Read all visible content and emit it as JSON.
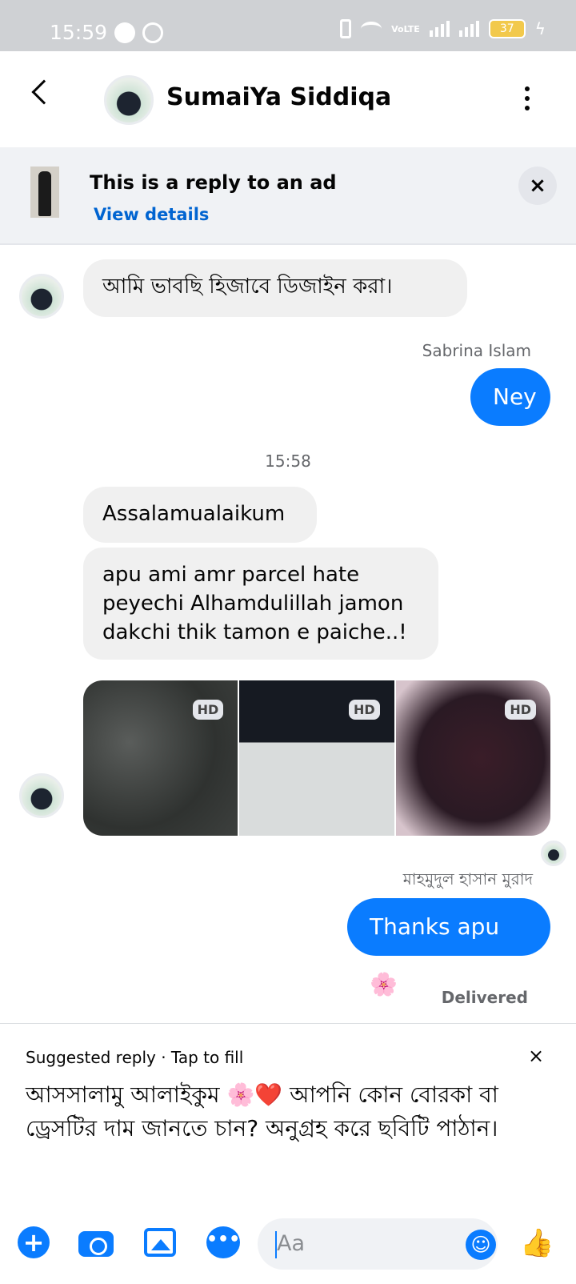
{
  "status_bar": {
    "time": "15:59",
    "battery": "37",
    "network": "VoLTE"
  },
  "header": {
    "contact_name": "SumaiYa Siddiqa"
  },
  "ad_banner": {
    "title": "This is a reply to an ad",
    "link": "View details",
    "close": "×"
  },
  "messages": {
    "m1": "আমি ভাবছি হিজাবে ডিজাইন করা।",
    "sender1": "Sabrina Islam",
    "m2": "Ney",
    "timestamp": "15:58",
    "m3": "Assalamualaikum",
    "m4": "apu ami amr parcel hate peyechi Alhamdulillah jamon dakchi thik tamon e paiche..!",
    "photos": [
      {
        "badge": "HD"
      },
      {
        "badge": "HD"
      },
      {
        "badge": "HD"
      }
    ],
    "sender2": "মাহমুদুল হাসান মুরাদ",
    "m5": "Thanks apu 🌸",
    "delivery_status": "Delivered"
  },
  "suggested_reply": {
    "label": "Suggested reply · Tap to fill",
    "close": "×",
    "text": "আসসালামু আলাইকুম 🌸❤️ আপনি কোন বোরকা বা ড্রেসটির দাম জানতে চান? অনুগ্রহ করে ছবিটি পাঠান।"
  },
  "composer": {
    "placeholder": "Aa",
    "plus_icon": "+",
    "chat_icon": "•••",
    "emoji_icon": "☺",
    "like_icon": "👍"
  },
  "colors": {
    "accent": "#0a7cff",
    "incoming_bubble": "#f0f0f0",
    "link": "#0064d1"
  }
}
